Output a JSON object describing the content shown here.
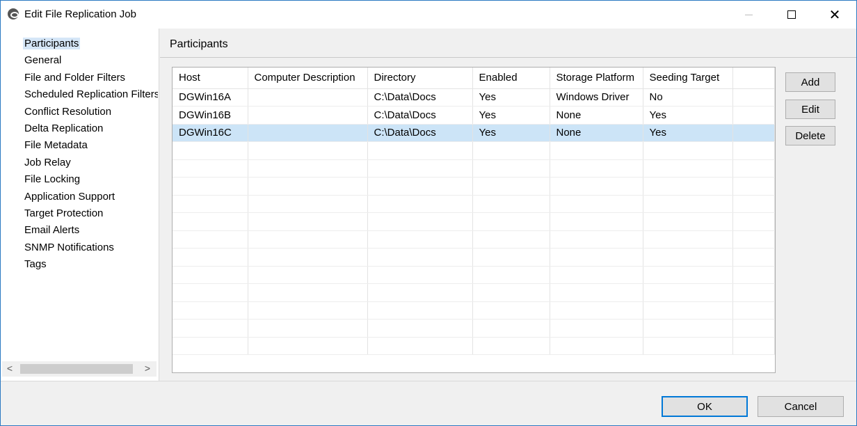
{
  "window": {
    "title": "Edit File Replication Job",
    "minimize_icon": "minimize-icon",
    "maximize_icon": "maximize-icon",
    "close_glyph": "✕"
  },
  "nav": {
    "items": [
      {
        "label": "Participants",
        "selected": true
      },
      {
        "label": "General"
      },
      {
        "label": "File and Folder Filters"
      },
      {
        "label": "Scheduled Replication Filters"
      },
      {
        "label": "Conflict Resolution"
      },
      {
        "label": "Delta Replication"
      },
      {
        "label": "File Metadata"
      },
      {
        "label": "Job Relay"
      },
      {
        "label": "File Locking"
      },
      {
        "label": "Application Support"
      },
      {
        "label": "Target Protection"
      },
      {
        "label": "Email Alerts"
      },
      {
        "label": "SNMP Notifications"
      },
      {
        "label": "Tags"
      }
    ],
    "scroll_left": "<",
    "scroll_right": ">"
  },
  "main": {
    "section_title": "Participants",
    "table": {
      "columns": [
        "Host",
        "Computer Description",
        "Directory",
        "Enabled",
        "Storage Platform",
        "Seeding Target"
      ],
      "rows": [
        {
          "host": "DGWin16A",
          "description": "",
          "directory": "C:\\Data\\Docs",
          "enabled": "Yes",
          "storage_platform": "Windows Driver",
          "seeding_target": "No"
        },
        {
          "host": "DGWin16B",
          "description": "",
          "directory": "C:\\Data\\Docs",
          "enabled": "Yes",
          "storage_platform": "None",
          "seeding_target": "Yes"
        },
        {
          "host": "DGWin16C",
          "description": "",
          "directory": "C:\\Data\\Docs",
          "enabled": "Yes",
          "storage_platform": "None",
          "seeding_target": "Yes",
          "selected": true
        }
      ]
    },
    "buttons": {
      "add": "Add",
      "edit": "Edit",
      "delete": "Delete"
    }
  },
  "footer": {
    "ok": "OK",
    "cancel": "Cancel"
  },
  "colors": {
    "selection": "#cce4f7",
    "window_border": "#2b79c2",
    "default_button_border": "#0078d7"
  }
}
